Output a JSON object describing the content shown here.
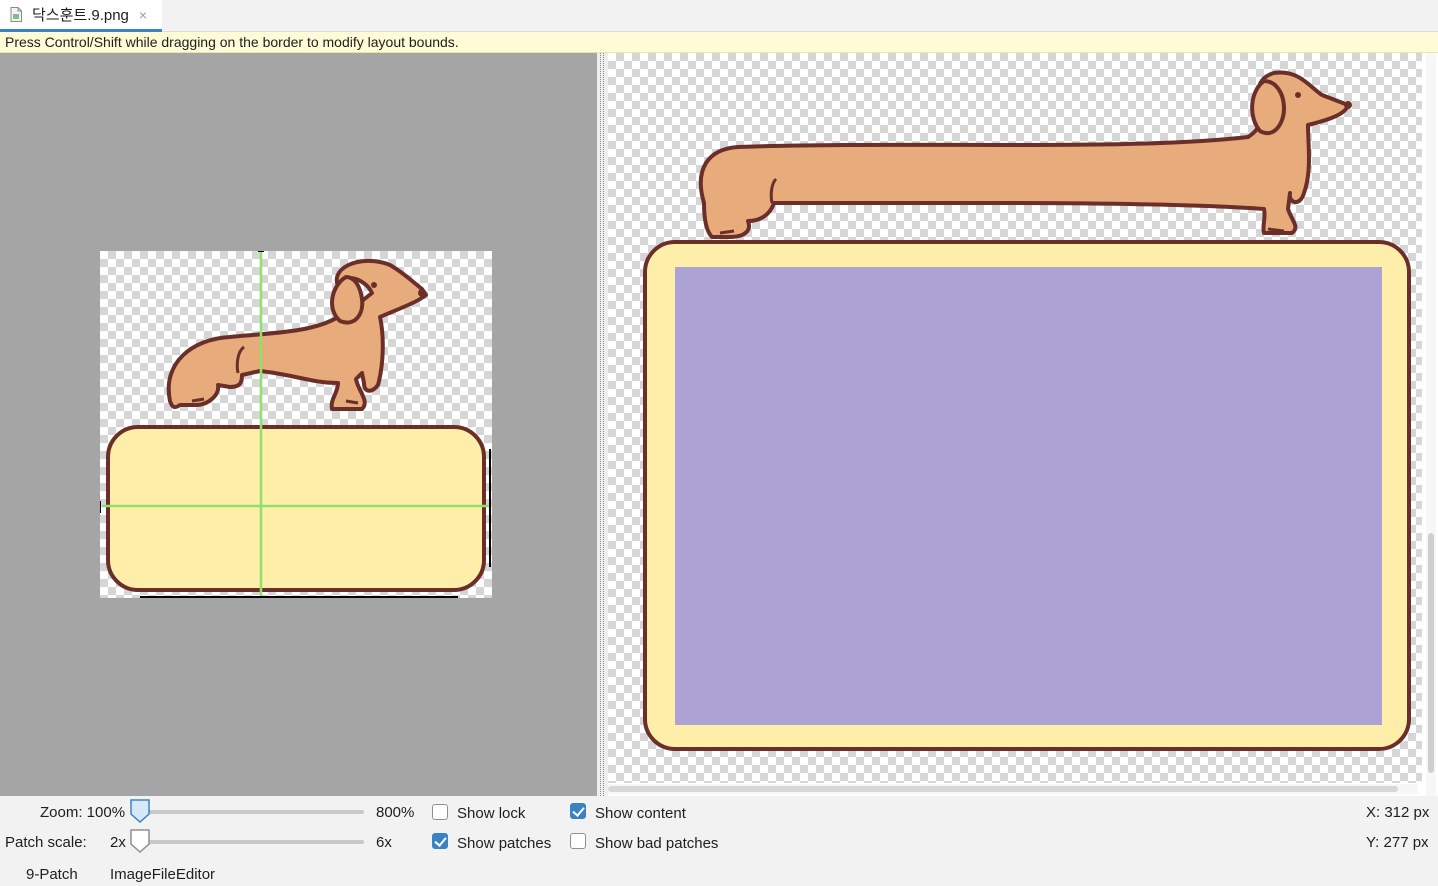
{
  "tab": {
    "title": "닥스훈트.9.png",
    "close": "×",
    "icon": "image-file-icon"
  },
  "hint": {
    "text": "Press Control/Shift while dragging on the border to modify layout bounds."
  },
  "controls": {
    "zoom_label": "Zoom: 100%",
    "zoom_max": "800%",
    "zoom_value": 0.0,
    "patch_scale_label": "Patch scale:",
    "patch_scale_min": "2x",
    "patch_scale_max": "6x",
    "patch_scale_value": 0.0,
    "show_lock": {
      "label": "Show lock",
      "checked": false
    },
    "show_patches": {
      "label": "Show patches",
      "checked": true
    },
    "show_content": {
      "label": "Show content",
      "checked": true
    },
    "show_bad_patches": {
      "label": "Show bad patches",
      "checked": false
    },
    "x_readout": "X: 312 px",
    "y_readout": "Y: 277 px"
  },
  "bottom_tabs": [
    "9-Patch",
    "ImageFileEditor"
  ],
  "colors": {
    "dog": "#e8ab7b",
    "outline": "#6b2f2a",
    "box_fill": "#ffeeaa",
    "content_area": "#ada2d4",
    "patch_line": "#8ee26b",
    "accent": "#3b82c4"
  }
}
